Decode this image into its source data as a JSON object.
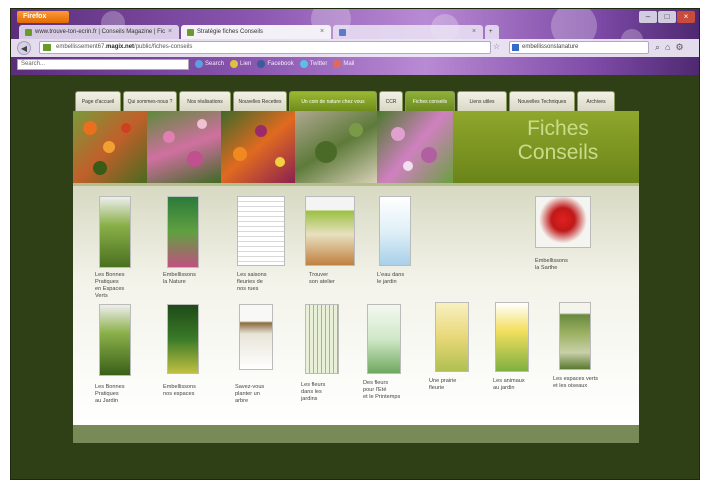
{
  "browser": {
    "app_menu": "Firefox",
    "window_controls": [
      "–",
      "□",
      "×"
    ],
    "tabs": [
      {
        "label": "www.trouve-ton-ecrin.fr | Conseils Magazine | Fiches...",
        "active": false
      },
      {
        "label": "Stratégie fiches Conseils",
        "active": true
      },
      {
        "label": "",
        "active": false
      }
    ],
    "url_host": "magix.net",
    "url_rest": "/public/fiches-conseils",
    "url_prefix": "embellissement67.",
    "search_text": "embellissonslanature",
    "toolbar_search_placeholder": "Search...",
    "toolbar_items": [
      "Search",
      "Lien",
      "Facebook",
      "Twitter",
      "Mail"
    ]
  },
  "site": {
    "nav": [
      {
        "label": "Page d'accueil",
        "style": "plain"
      },
      {
        "label": "Qui sommes-nous ?",
        "style": "plain"
      },
      {
        "label": "Nos réalisations",
        "style": "plain"
      },
      {
        "label": "Nouvelles Recettes",
        "style": "plain"
      },
      {
        "label": "Un coin de nature chez vous",
        "style": "active"
      },
      {
        "label": "CCR",
        "style": "plain"
      },
      {
        "label": "Fiches conseils",
        "style": "green"
      },
      {
        "label": "Liens utiles",
        "style": "plain"
      },
      {
        "label": "Nouvelles Techniques",
        "style": "plain"
      },
      {
        "label": "Archives",
        "style": "plain"
      }
    ],
    "banner_title_line1": "Fiches",
    "banner_title_line2": "Conseils",
    "fiches_row1": [
      {
        "caption": "Les Bonnes\nPratiques\nen Espaces\nVerts",
        "theme": "plants"
      },
      {
        "caption": "Embellissons\nla Nature",
        "theme": "green"
      },
      {
        "caption": "Les saisons\nfleuries de\nnos rues",
        "theme": "doc"
      },
      {
        "caption": "Trouver\nson atelier",
        "theme": "poster"
      },
      {
        "caption": "L'eau dans\nle jardin",
        "theme": "water"
      },
      {
        "caption": "Embellissons\nla Sarthe",
        "theme": "flower"
      }
    ],
    "fiches_row2": [
      {
        "caption": "Les Bonnes\nPratiques\nau Jardin",
        "theme": "plants"
      },
      {
        "caption": "Embellissons\nnos espaces",
        "theme": "darkgreen"
      },
      {
        "caption": "Savez-vous\nplanter un\narbre",
        "theme": "tree"
      },
      {
        "caption": "Les fleurs\ndans les\njardins",
        "theme": "meadow"
      },
      {
        "caption": "Des fleurs\npour l'Eté\net le Printemps",
        "theme": "water"
      },
      {
        "caption": "Une prairie\nfleurie",
        "theme": "yellow"
      },
      {
        "caption": "Les animaux\nau jardin",
        "theme": "yellowgreen"
      },
      {
        "caption": "Les espaces verts\net les oiseaux",
        "theme": "field"
      }
    ]
  },
  "colors": {
    "page_background": "#2f3f16",
    "accent_green": "#8fa72c",
    "banner_text": "#c9dc8a"
  }
}
